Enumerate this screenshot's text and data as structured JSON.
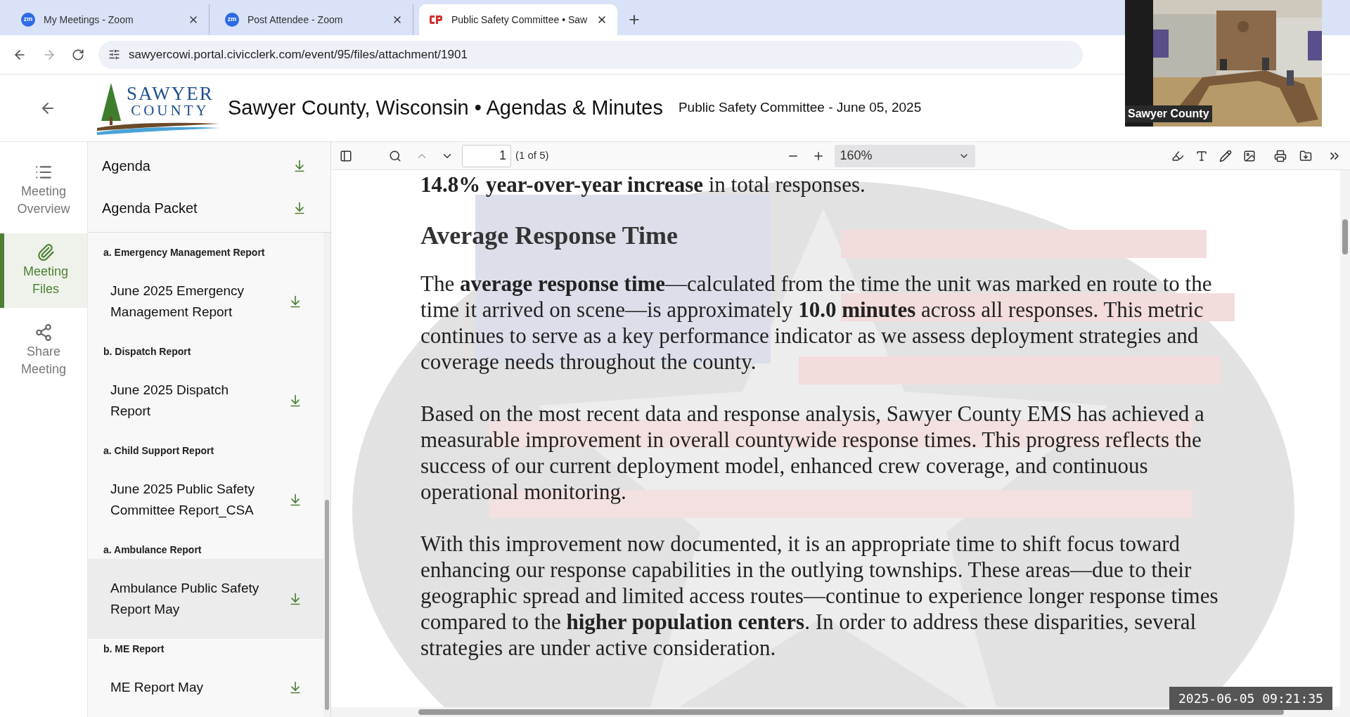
{
  "browser": {
    "tabs": [
      {
        "title": "My Meetings - Zoom",
        "kind": "zoom",
        "icon_text": "zm",
        "selected": false
      },
      {
        "title": "Post Attendee - Zoom",
        "kind": "zoom",
        "icon_text": "zm",
        "selected": false
      },
      {
        "title": "Public Safety Committee • Saw",
        "kind": "civic",
        "selected": true
      }
    ],
    "address": "sawyercowi.portal.civicclerk.com/event/95/files/attachment/1901"
  },
  "header": {
    "logo_top": "SAWYER",
    "logo_bottom": "COUNTY",
    "title": "Sawyer County, Wisconsin • Agendas & Minutes",
    "subtitle": "Public Safety Committee - June 05, 2025"
  },
  "nav": [
    {
      "kind": "list",
      "label": "Meeting Overview",
      "selected": false
    },
    {
      "kind": "clip",
      "label": "Meeting Files",
      "selected": true
    },
    {
      "kind": "share",
      "label": "Share Meeting",
      "selected": false
    }
  ],
  "files": {
    "pinned": [
      {
        "label": "Agenda"
      },
      {
        "label": "Agenda Packet"
      }
    ],
    "sections": [
      {
        "heading": "a. Emergency Management Report",
        "files": [
          {
            "label": "June 2025 Emergency Management Report",
            "selected": false
          }
        ]
      },
      {
        "heading": "b. Dispatch Report",
        "files": [
          {
            "label": "June 2025 Dispatch Report",
            "selected": false
          }
        ]
      },
      {
        "heading": "a. Child Support Report",
        "files": [
          {
            "label": "June 2025 Public Safety Committee Report_CSA",
            "selected": false
          }
        ]
      },
      {
        "heading": "a. Ambulance Report",
        "files": [
          {
            "label": "Ambulance Public Safety Report May",
            "selected": true
          }
        ]
      },
      {
        "heading": "b. ME Report",
        "files": [
          {
            "label": "ME Report May",
            "selected": false
          }
        ]
      }
    ]
  },
  "pdf_toolbar": {
    "page": "1",
    "page_count": "(1 of 5)",
    "zoom": "160%"
  },
  "document": {
    "lead": "**14.8% year-over-year increase** in total responses.",
    "heading": "Average Response Time",
    "paragraphs": [
      "The **average response time**—calculated from the time the unit was marked en route to the time it arrived on scene—is approximately **10.0 minutes** across all responses. This metric continues to serve as a key performance indicator as we assess deployment strategies and coverage needs throughout the county.",
      "Based on the most recent data and response analysis, Sawyer County EMS has achieved a measurable improvement in overall countywide response times. This progress reflects the success of our current deployment model, enhanced crew coverage, and continuous operational monitoring.",
      "With this improvement now documented, it is an appropriate time to shift focus toward enhancing our response capabilities in the outlying townships. These areas—due to their geographic spread and limited access routes—continue to experience longer response times compared to the **higher population centers**. In order to address these disparities, several strategies are under active consideration."
    ]
  },
  "video": {
    "label": "Sawyer County"
  },
  "timestamp": "2025-06-05 09:21:35"
}
